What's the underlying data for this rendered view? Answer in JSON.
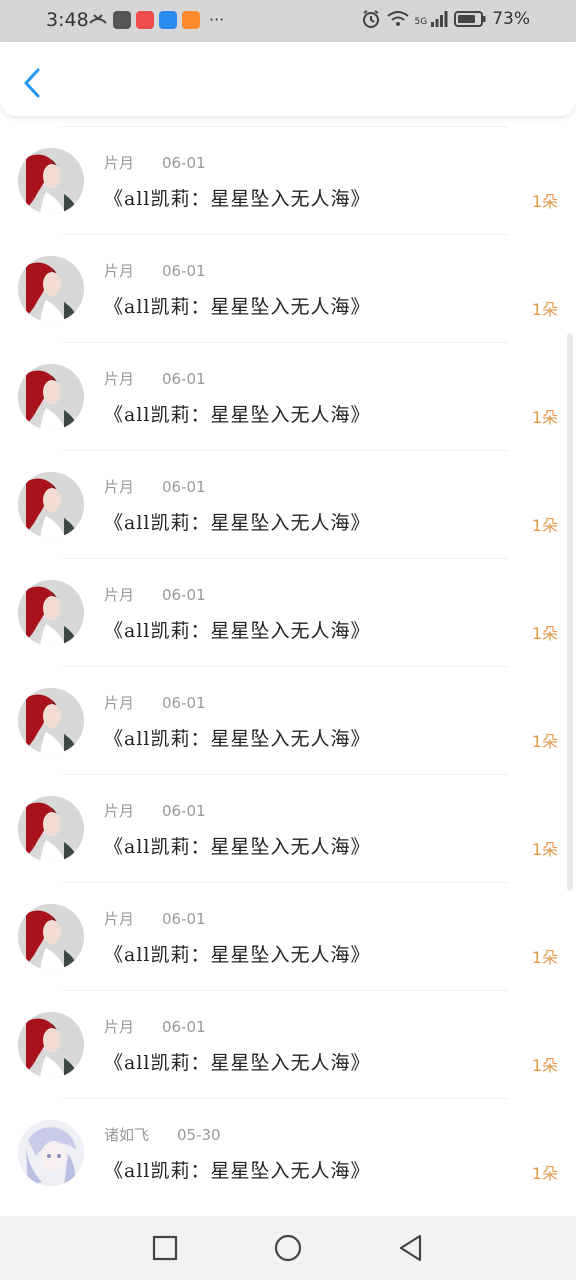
{
  "status": {
    "time": "3:48",
    "battery": "73%",
    "network": "5G"
  },
  "icons": {
    "back": "chevron-left-icon",
    "nav_recent": "square-icon",
    "nav_home": "circle-icon",
    "nav_back": "triangle-left-icon"
  },
  "colors": {
    "accent": "#2196f3",
    "count": "#e59a4a"
  },
  "list": {
    "items": [
      {
        "author": "片月",
        "date": "06-01",
        "title": "《all凯莉：星星坠入无人海》",
        "count": "1朵"
      },
      {
        "author": "片月",
        "date": "06-01",
        "title": "《all凯莉：星星坠入无人海》",
        "count": "1朵"
      },
      {
        "author": "片月",
        "date": "06-01",
        "title": "《all凯莉：星星坠入无人海》",
        "count": "1朵"
      },
      {
        "author": "片月",
        "date": "06-01",
        "title": "《all凯莉：星星坠入无人海》",
        "count": "1朵"
      },
      {
        "author": "片月",
        "date": "06-01",
        "title": "《all凯莉：星星坠入无人海》",
        "count": "1朵"
      },
      {
        "author": "片月",
        "date": "06-01",
        "title": "《all凯莉：星星坠入无人海》",
        "count": "1朵"
      },
      {
        "author": "片月",
        "date": "06-01",
        "title": "《all凯莉：星星坠入无人海》",
        "count": "1朵"
      },
      {
        "author": "片月",
        "date": "06-01",
        "title": "《all凯莉：星星坠入无人海》",
        "count": "1朵"
      },
      {
        "author": "片月",
        "date": "06-01",
        "title": "《all凯莉：星星坠入无人海》",
        "count": "1朵"
      },
      {
        "author": "诸如飞",
        "date": "05-30",
        "title": "《all凯莉：星星坠入无人海》",
        "count": "1朵"
      }
    ]
  }
}
